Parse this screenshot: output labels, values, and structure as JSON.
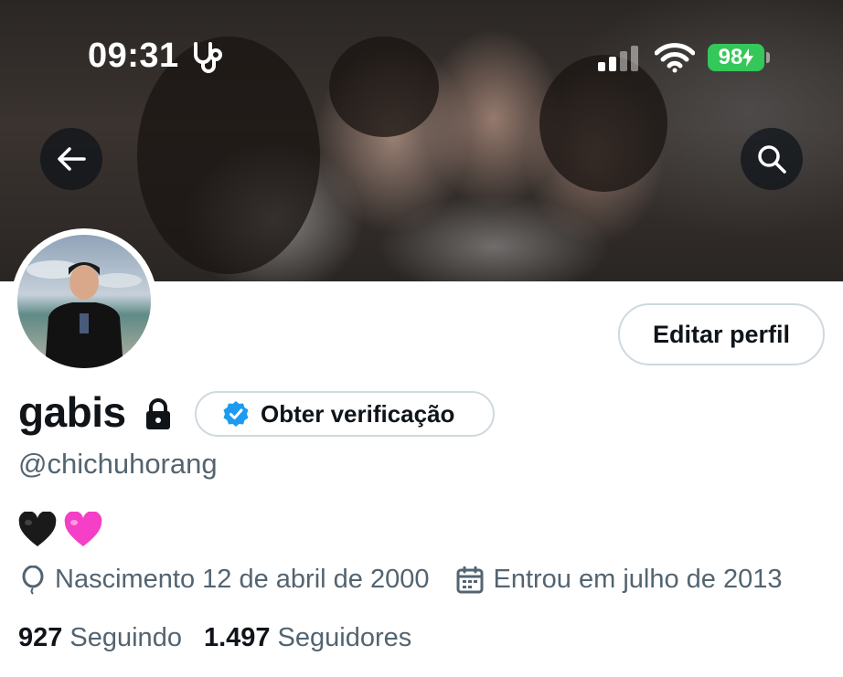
{
  "status_bar": {
    "time": "09:31",
    "battery": "98",
    "icons": [
      "stethoscope-icon",
      "cellular-signal-icon",
      "wifi-icon",
      "battery-charging-icon"
    ]
  },
  "header": {
    "back_icon": "arrow-left-icon",
    "search_icon": "search-icon"
  },
  "profile": {
    "display_name": "gabis",
    "handle": "@chichuhorang",
    "bio": [
      "🖤",
      "💗"
    ],
    "edit_button_label": "Editar perfil",
    "verification_button_label": "Obter verificação",
    "birthdate": "Nascimento 12 de abril de 2000",
    "joined": "Entrou em julho de 2013",
    "following_count": "927",
    "following_label": "Seguindo",
    "followers_count": "1.497",
    "followers_label": "Seguidores"
  },
  "colors": {
    "text_primary": "#0f1419",
    "text_secondary": "#536471",
    "border": "#cfd9de",
    "verified_blue": "#1d9bf0",
    "battery_green": "#34c759"
  }
}
